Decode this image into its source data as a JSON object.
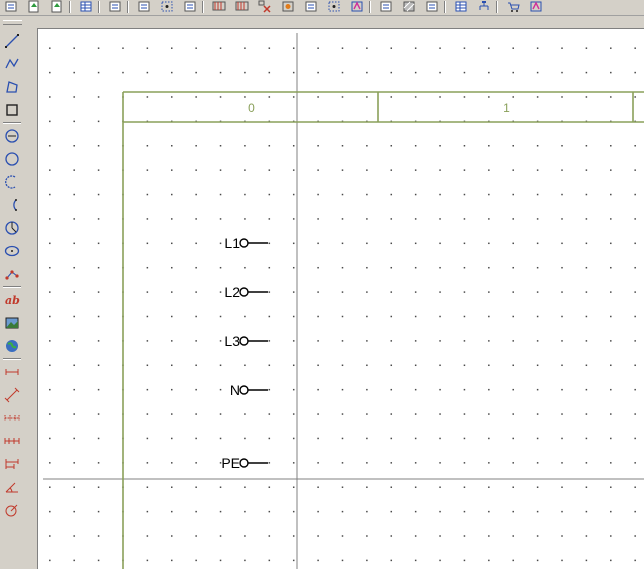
{
  "toolbar": {
    "groups": [
      [
        "new-page-icon",
        "save-green-icon",
        "export-green-icon"
      ],
      [
        "properties-icon"
      ],
      [
        "component-icon"
      ],
      [
        "select-area-icon",
        "select-dots-icon",
        "select-box-icon"
      ],
      [
        "terminal-strip-icon",
        "filter-wire-icon",
        "filter-red-icon",
        "filter-orange-icon",
        "filter-box-icon",
        "filter-dots-icon",
        "filter-pink-icon"
      ],
      [
        "edit-text-icon",
        "hatch-icon",
        "insert-block-icon"
      ],
      [
        "table-icon",
        "tree-icon"
      ],
      [
        "cart-icon",
        "check-icon"
      ]
    ]
  },
  "sidebar": {
    "tools": [
      "line-tool-icon",
      "polyline-tool-icon",
      "polygon-tool-icon",
      "rectangle-tool-icon",
      "circle-center-tool-icon",
      "circle-tool-icon",
      "arc-tool-icon",
      "arc-3pt-tool-icon",
      "angle-tool-icon",
      "ellipse-tool-icon",
      "node-tool-icon",
      "text-tool-icon",
      "image-tool-icon",
      "globe-tool-icon",
      "dimension-h-tool-icon",
      "dimension-diag-tool-icon",
      "dimension-chain-tool-icon",
      "dimension-chain2-tool-icon",
      "dimension-base-tool-icon",
      "dimension-angle-tool-icon",
      "dimension-radius-tool-icon"
    ]
  },
  "drawing": {
    "columns": [
      {
        "label": "0"
      },
      {
        "label": "1"
      }
    ],
    "terminals": [
      {
        "label": "L1"
      },
      {
        "label": "L2"
      },
      {
        "label": "L3"
      },
      {
        "label": "N"
      },
      {
        "label": "PE"
      }
    ],
    "colors": {
      "frame": "#8aa05a",
      "crosshair": "#808080",
      "terminal": "#000000"
    }
  }
}
